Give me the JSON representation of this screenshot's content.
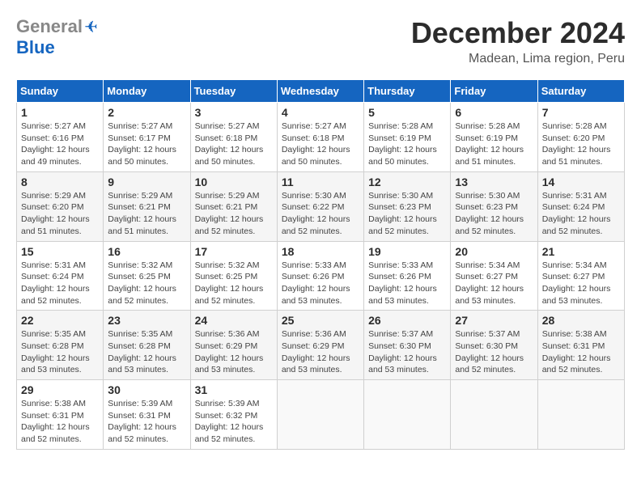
{
  "header": {
    "logo_general": "General",
    "logo_blue": "Blue",
    "title": "December 2024",
    "subtitle": "Madean, Lima region, Peru"
  },
  "days_of_week": [
    "Sunday",
    "Monday",
    "Tuesday",
    "Wednesday",
    "Thursday",
    "Friday",
    "Saturday"
  ],
  "weeks": [
    [
      {
        "day": "1",
        "sunrise": "5:27 AM",
        "sunset": "6:16 PM",
        "daylight": "12 hours and 49 minutes."
      },
      {
        "day": "2",
        "sunrise": "5:27 AM",
        "sunset": "6:17 PM",
        "daylight": "12 hours and 50 minutes."
      },
      {
        "day": "3",
        "sunrise": "5:27 AM",
        "sunset": "6:18 PM",
        "daylight": "12 hours and 50 minutes."
      },
      {
        "day": "4",
        "sunrise": "5:27 AM",
        "sunset": "6:18 PM",
        "daylight": "12 hours and 50 minutes."
      },
      {
        "day": "5",
        "sunrise": "5:28 AM",
        "sunset": "6:19 PM",
        "daylight": "12 hours and 50 minutes."
      },
      {
        "day": "6",
        "sunrise": "5:28 AM",
        "sunset": "6:19 PM",
        "daylight": "12 hours and 51 minutes."
      },
      {
        "day": "7",
        "sunrise": "5:28 AM",
        "sunset": "6:20 PM",
        "daylight": "12 hours and 51 minutes."
      }
    ],
    [
      {
        "day": "8",
        "sunrise": "5:29 AM",
        "sunset": "6:20 PM",
        "daylight": "12 hours and 51 minutes."
      },
      {
        "day": "9",
        "sunrise": "5:29 AM",
        "sunset": "6:21 PM",
        "daylight": "12 hours and 51 minutes."
      },
      {
        "day": "10",
        "sunrise": "5:29 AM",
        "sunset": "6:21 PM",
        "daylight": "12 hours and 52 minutes."
      },
      {
        "day": "11",
        "sunrise": "5:30 AM",
        "sunset": "6:22 PM",
        "daylight": "12 hours and 52 minutes."
      },
      {
        "day": "12",
        "sunrise": "5:30 AM",
        "sunset": "6:23 PM",
        "daylight": "12 hours and 52 minutes."
      },
      {
        "day": "13",
        "sunrise": "5:30 AM",
        "sunset": "6:23 PM",
        "daylight": "12 hours and 52 minutes."
      },
      {
        "day": "14",
        "sunrise": "5:31 AM",
        "sunset": "6:24 PM",
        "daylight": "12 hours and 52 minutes."
      }
    ],
    [
      {
        "day": "15",
        "sunrise": "5:31 AM",
        "sunset": "6:24 PM",
        "daylight": "12 hours and 52 minutes."
      },
      {
        "day": "16",
        "sunrise": "5:32 AM",
        "sunset": "6:25 PM",
        "daylight": "12 hours and 52 minutes."
      },
      {
        "day": "17",
        "sunrise": "5:32 AM",
        "sunset": "6:25 PM",
        "daylight": "12 hours and 52 minutes."
      },
      {
        "day": "18",
        "sunrise": "5:33 AM",
        "sunset": "6:26 PM",
        "daylight": "12 hours and 53 minutes."
      },
      {
        "day": "19",
        "sunrise": "5:33 AM",
        "sunset": "6:26 PM",
        "daylight": "12 hours and 53 minutes."
      },
      {
        "day": "20",
        "sunrise": "5:34 AM",
        "sunset": "6:27 PM",
        "daylight": "12 hours and 53 minutes."
      },
      {
        "day": "21",
        "sunrise": "5:34 AM",
        "sunset": "6:27 PM",
        "daylight": "12 hours and 53 minutes."
      }
    ],
    [
      {
        "day": "22",
        "sunrise": "5:35 AM",
        "sunset": "6:28 PM",
        "daylight": "12 hours and 53 minutes."
      },
      {
        "day": "23",
        "sunrise": "5:35 AM",
        "sunset": "6:28 PM",
        "daylight": "12 hours and 53 minutes."
      },
      {
        "day": "24",
        "sunrise": "5:36 AM",
        "sunset": "6:29 PM",
        "daylight": "12 hours and 53 minutes."
      },
      {
        "day": "25",
        "sunrise": "5:36 AM",
        "sunset": "6:29 PM",
        "daylight": "12 hours and 53 minutes."
      },
      {
        "day": "26",
        "sunrise": "5:37 AM",
        "sunset": "6:30 PM",
        "daylight": "12 hours and 53 minutes."
      },
      {
        "day": "27",
        "sunrise": "5:37 AM",
        "sunset": "6:30 PM",
        "daylight": "12 hours and 52 minutes."
      },
      {
        "day": "28",
        "sunrise": "5:38 AM",
        "sunset": "6:31 PM",
        "daylight": "12 hours and 52 minutes."
      }
    ],
    [
      {
        "day": "29",
        "sunrise": "5:38 AM",
        "sunset": "6:31 PM",
        "daylight": "12 hours and 52 minutes."
      },
      {
        "day": "30",
        "sunrise": "5:39 AM",
        "sunset": "6:31 PM",
        "daylight": "12 hours and 52 minutes."
      },
      {
        "day": "31",
        "sunrise": "5:39 AM",
        "sunset": "6:32 PM",
        "daylight": "12 hours and 52 minutes."
      },
      null,
      null,
      null,
      null
    ]
  ],
  "labels": {
    "sunrise_prefix": "Sunrise: ",
    "sunset_prefix": "Sunset: ",
    "daylight_prefix": "Daylight: "
  }
}
